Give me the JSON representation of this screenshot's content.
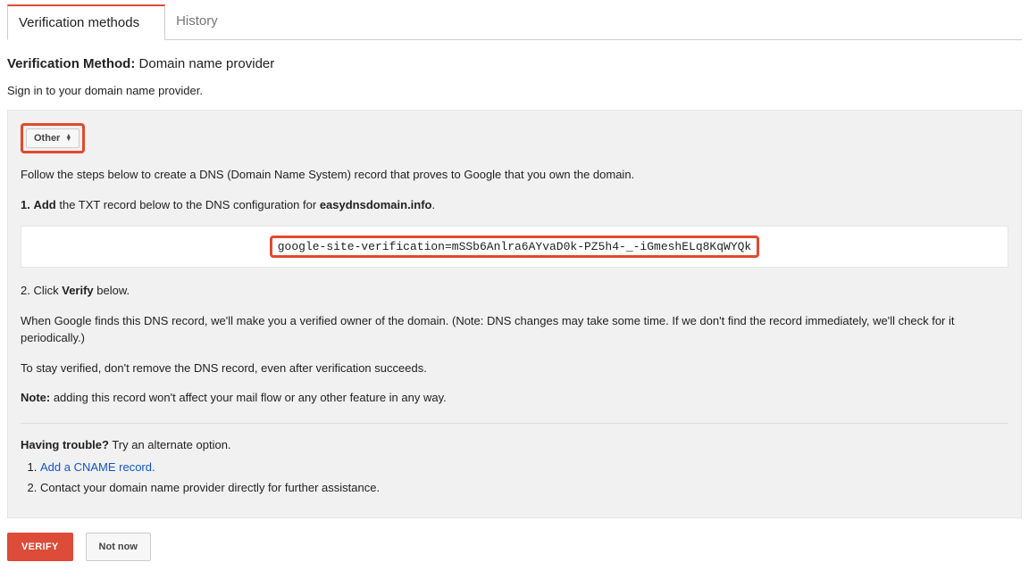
{
  "tabs": {
    "active": "Verification methods",
    "inactive": "History"
  },
  "heading": {
    "label": "Verification Method:",
    "value": "Domain name provider"
  },
  "signin_text": "Sign in to your domain name provider.",
  "dropdown": {
    "selected": "Other"
  },
  "intro": "Follow the steps below to create a DNS (Domain Name System) record that proves to Google that you own the domain.",
  "step1": {
    "num": "1.",
    "action": "Add",
    "mid": " the TXT record below to the DNS configuration for ",
    "domain": "easydnsdomain.info",
    "end": "."
  },
  "txt_record": "google-site-verification=mSSb6Anlra6AYvaD0k-PZ5h4-_-iGmeshELq8KqWYQk",
  "step2": {
    "pre": "2. Click ",
    "bold": "Verify",
    "post": " below."
  },
  "explain": "When Google finds this DNS record, we'll make you a verified owner of the domain. (Note: DNS changes may take some time. If we don't find the record immediately, we'll check for it periodically.)",
  "stay": "To stay verified, don't remove the DNS record, even after verification succeeds.",
  "note": {
    "label": "Note:",
    "text": " adding this record won't affect your mail flow or any other feature in any way."
  },
  "trouble": {
    "label": "Having trouble?",
    "text": " Try an alternate option."
  },
  "alt": {
    "cname": "Add a CNAME record.",
    "contact": "Contact your domain name provider directly for further assistance."
  },
  "buttons": {
    "verify": "VERIFY",
    "notnow": "Not now"
  }
}
